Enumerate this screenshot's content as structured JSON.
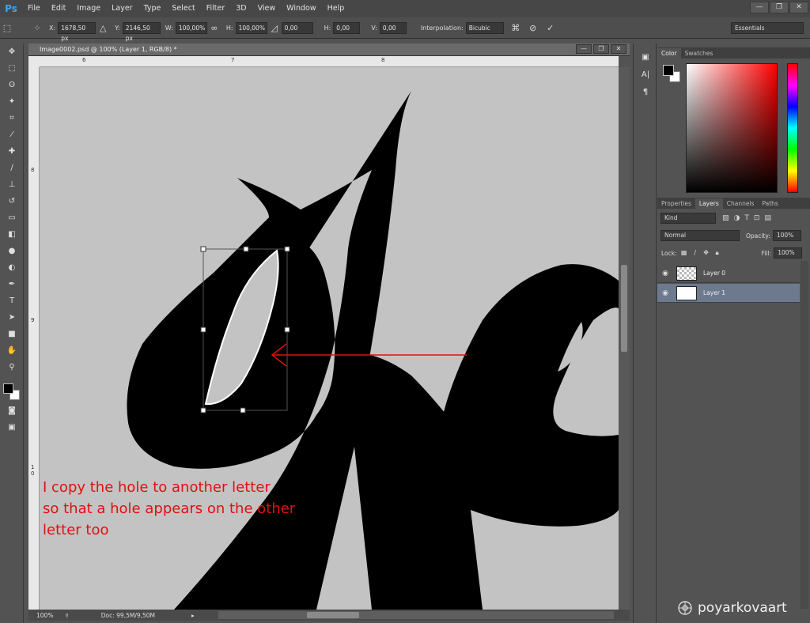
{
  "app": {
    "logo": "Ps"
  },
  "menu": [
    "File",
    "Edit",
    "Image",
    "Layer",
    "Type",
    "Select",
    "Filter",
    "3D",
    "View",
    "Window",
    "Help"
  ],
  "window_controls": [
    "—",
    "❐",
    "✕"
  ],
  "options": {
    "x_label": "X:",
    "x_value": "1678,50 px",
    "y_label": "Y:",
    "y_value": "2146,50 px",
    "w_label": "W:",
    "w_value": "100,00%",
    "h_label": "H:",
    "h_value": "100,00%",
    "angle_value": "0,00",
    "hskew_label": "H:",
    "hskew_value": "0,00",
    "vskew_label": "V:",
    "vskew_value": "0,00",
    "interp_label": "Interpolation:",
    "interp_value": "Bicubic",
    "workspace": "Essentials"
  },
  "document": {
    "title": "Image0002.psd @ 100% (Layer 1, RGB/8) *",
    "ruler_top": [
      "6",
      "7",
      "8"
    ],
    "ruler_left": [
      "8",
      "9",
      "1 0"
    ]
  },
  "annotation": {
    "lines": [
      "I copy the hole to another letter",
      "so that a hole appears on the other",
      "letter too"
    ],
    "color": "#e01010"
  },
  "status": {
    "zoom": "100%",
    "doc": "Doc: 99,5M/9,50M"
  },
  "color_panel": {
    "tabs": [
      "Color",
      "Swatches"
    ]
  },
  "layers_panel": {
    "tabs": [
      "Properties",
      "Layers",
      "Channels",
      "Paths"
    ],
    "kind": "Kind",
    "blend": "Normal",
    "opacity_label": "Opacity:",
    "opacity_value": "100%",
    "lock_label": "Lock:",
    "fill_label": "Fill:",
    "fill_value": "100%",
    "layers": [
      {
        "name": "Layer 0",
        "thumb": "transparent",
        "selected": false
      },
      {
        "name": "Layer 1",
        "thumb": "white",
        "selected": true
      }
    ]
  },
  "watermark": "poyarkovaart"
}
